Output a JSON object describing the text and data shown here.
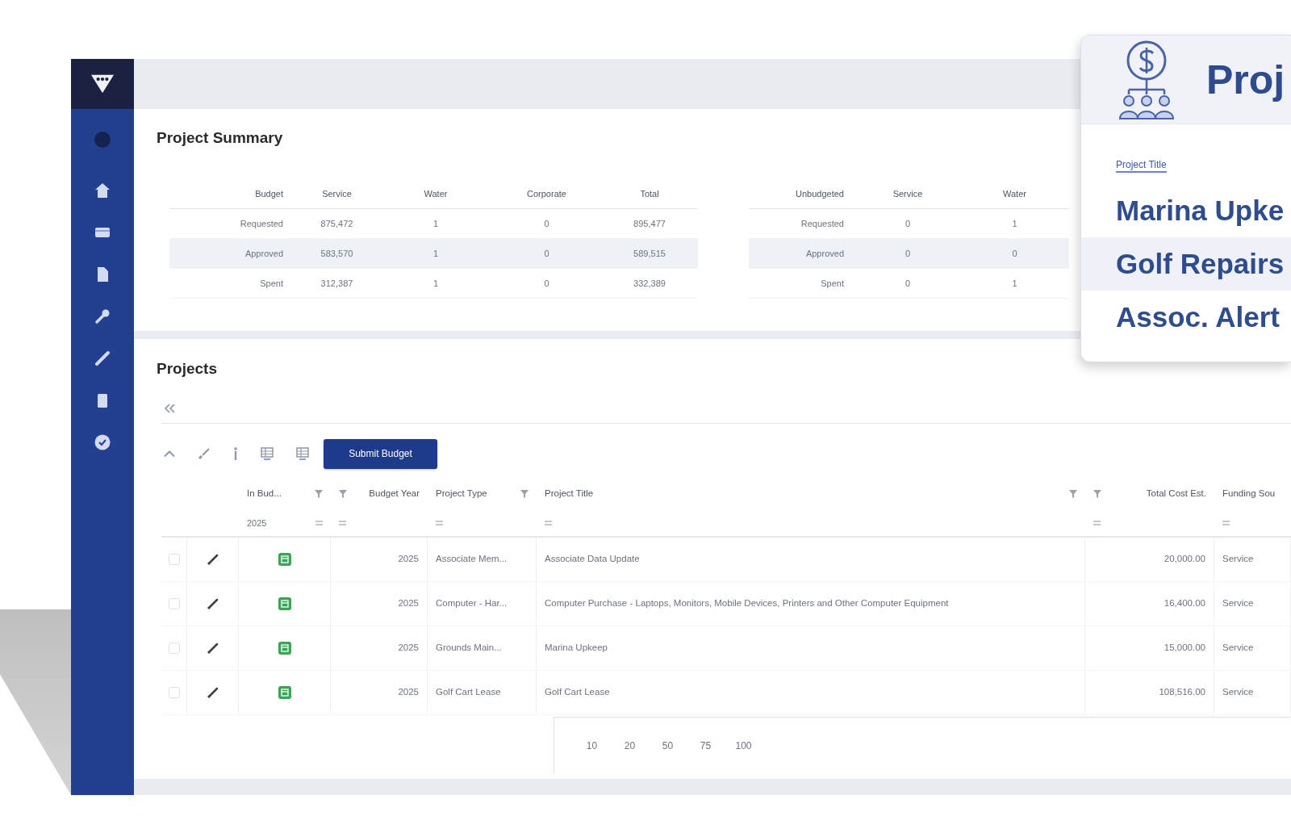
{
  "summary": {
    "title": "Project Summary",
    "tables": [
      {
        "columns": [
          "Budget",
          "Service",
          "Water",
          "Corporate",
          "Total"
        ],
        "rows": [
          {
            "cells": [
              "Requested",
              "875,472",
              "1",
              "0",
              "895,477"
            ],
            "selected": false
          },
          {
            "cells": [
              "Approved",
              "583,570",
              "1",
              "0",
              "589,515"
            ],
            "selected": true
          },
          {
            "cells": [
              "Spent",
              "312,387",
              "1",
              "0",
              "332,389"
            ],
            "selected": false
          }
        ]
      },
      {
        "columns": [
          "Unbudgeted",
          "Service",
          "Water"
        ],
        "rows": [
          {
            "cells": [
              "Requested",
              "0",
              "1"
            ],
            "selected": false
          },
          {
            "cells": [
              "Approved",
              "0",
              "0"
            ],
            "selected": true
          },
          {
            "cells": [
              "Spent",
              "0",
              "1"
            ],
            "selected": false
          }
        ]
      }
    ]
  },
  "projects": {
    "title": "Projects",
    "button": "Submit Budget",
    "columns": [
      {
        "kind": "select"
      },
      {
        "kind": "edit"
      },
      {
        "kind": "status",
        "label": "In Bud...",
        "filter": true,
        "filter_value": "2025"
      },
      {
        "kind": "number",
        "label": "Budget Year",
        "filter": true
      },
      {
        "kind": "text",
        "label": "Project Type",
        "filter": true
      },
      {
        "kind": "text",
        "label": "Project Title",
        "filter": true
      },
      {
        "kind": "number",
        "label": "Total Cost Est.",
        "filter": true
      },
      {
        "kind": "text",
        "label": "Funding Sou",
        "filter": false
      }
    ],
    "rows": [
      {
        "checked": false,
        "in_budget": true,
        "cells": [
          "",
          "",
          "",
          "2025",
          "Associate Mem...",
          "Associate Data Update",
          "20,000.00",
          "Service"
        ]
      },
      {
        "checked": false,
        "in_budget": true,
        "cells": [
          "",
          "",
          "",
          "2025",
          "Computer - Har...",
          "Computer Purchase - Laptops, Monitors, Mobile Devices, Printers and Other Computer Equipment",
          "16,400.00",
          "Service"
        ]
      },
      {
        "checked": false,
        "in_budget": true,
        "cells": [
          "",
          "",
          "",
          "2025",
          "Grounds Main...",
          "Marina Upkeep",
          "15,000.00",
          "Service"
        ]
      },
      {
        "checked": false,
        "in_budget": true,
        "cells": [
          "",
          "",
          "",
          "2025",
          "Golf Cart Lease",
          "Golf Cart Lease",
          "108,516.00",
          "Service"
        ]
      }
    ],
    "page_sizes": [
      "10",
      "20",
      "50",
      "75",
      "100"
    ]
  },
  "popup": {
    "title": "Proj",
    "label": "Project Title",
    "items": [
      {
        "text": "Marina Upke",
        "selected": false
      },
      {
        "text": "Golf Repairs",
        "selected": true
      },
      {
        "text": "Assoc. Alert",
        "selected": false
      }
    ]
  }
}
